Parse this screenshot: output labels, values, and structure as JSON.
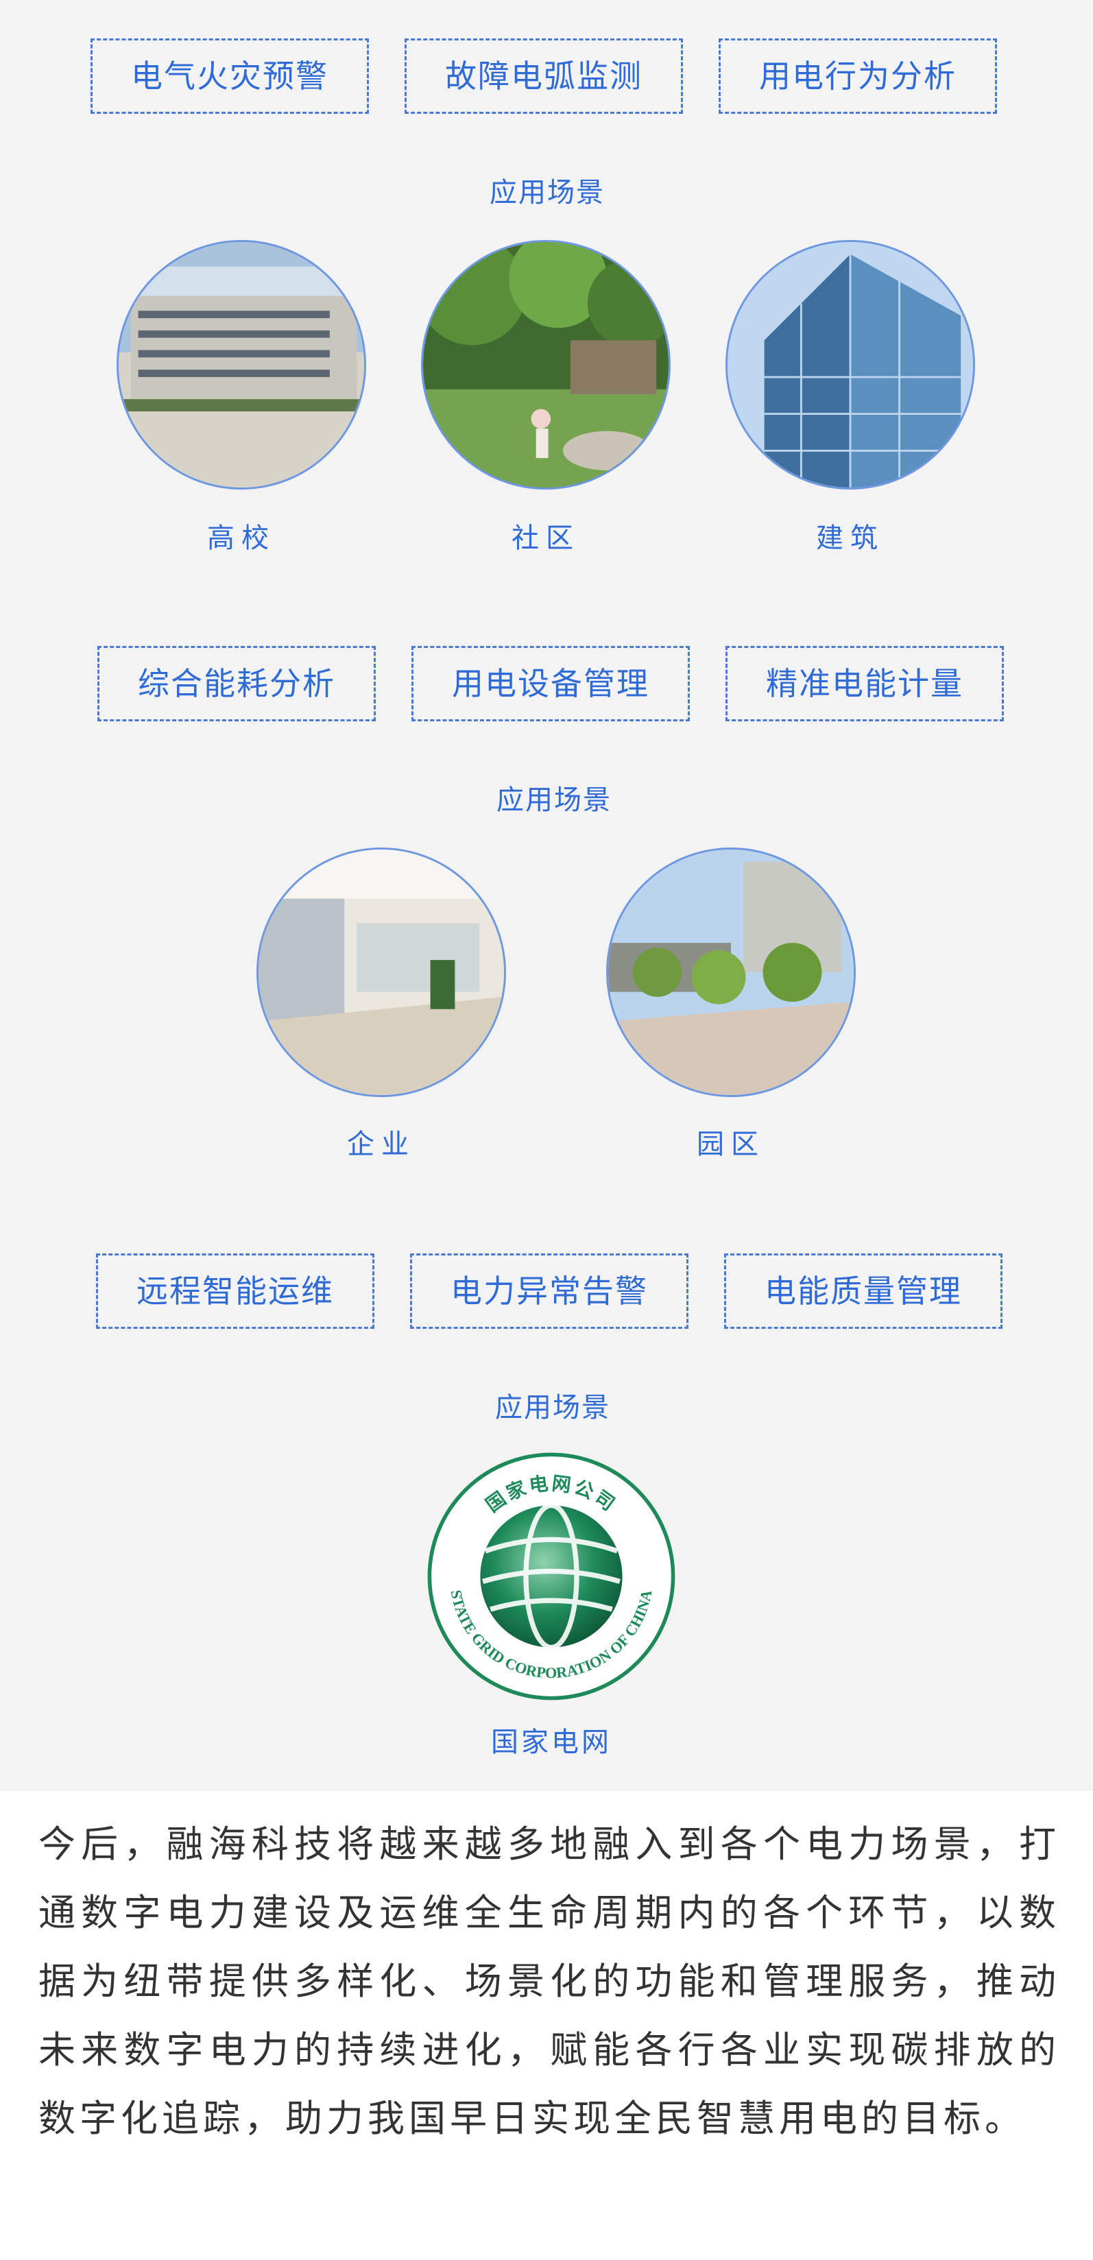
{
  "groups": [
    {
      "tags": [
        "电气火灾预警",
        "故障电弧监测",
        "用电行为分析"
      ],
      "scene_title": "应用场景",
      "scenes": [
        {
          "caption": "高校",
          "image": "campus-building-photo"
        },
        {
          "caption": "社区",
          "image": "community-garden-photo"
        },
        {
          "caption": "建筑",
          "image": "glass-building-photo"
        }
      ]
    },
    {
      "tags": [
        "综合能耗分析",
        "用电设备管理",
        "精准电能计量"
      ],
      "scene_title": "应用场景",
      "scenes": [
        {
          "caption": "企业",
          "image": "office-interior-photo"
        },
        {
          "caption": "园区",
          "image": "park-plaza-photo"
        }
      ]
    },
    {
      "tags": [
        "远程智能运维",
        "电力异常告警",
        "电能质量管理"
      ],
      "scene_title": "应用场景",
      "logo": {
        "text_cn": "国家电网公司",
        "text_en": "STATE GRID CORPORATION OF CHINA",
        "caption": "国家电网"
      }
    }
  ],
  "closing_paragraph": "今后，融海科技将越来越多地融入到各个电力场景，打通数字电力建设及运维全生命周期内的各个环节，以数据为纽带提供多样化、场景化的功能和管理服务，推动未来数字电力的持续进化，赋能各行各业实现碳排放的数字化追踪，助力我国早日实现全民智慧用电的目标。",
  "colors": {
    "accent": "#2f6bd6",
    "panel_bg": "#f3f3f3",
    "logo_green": "#1e8a5a"
  }
}
